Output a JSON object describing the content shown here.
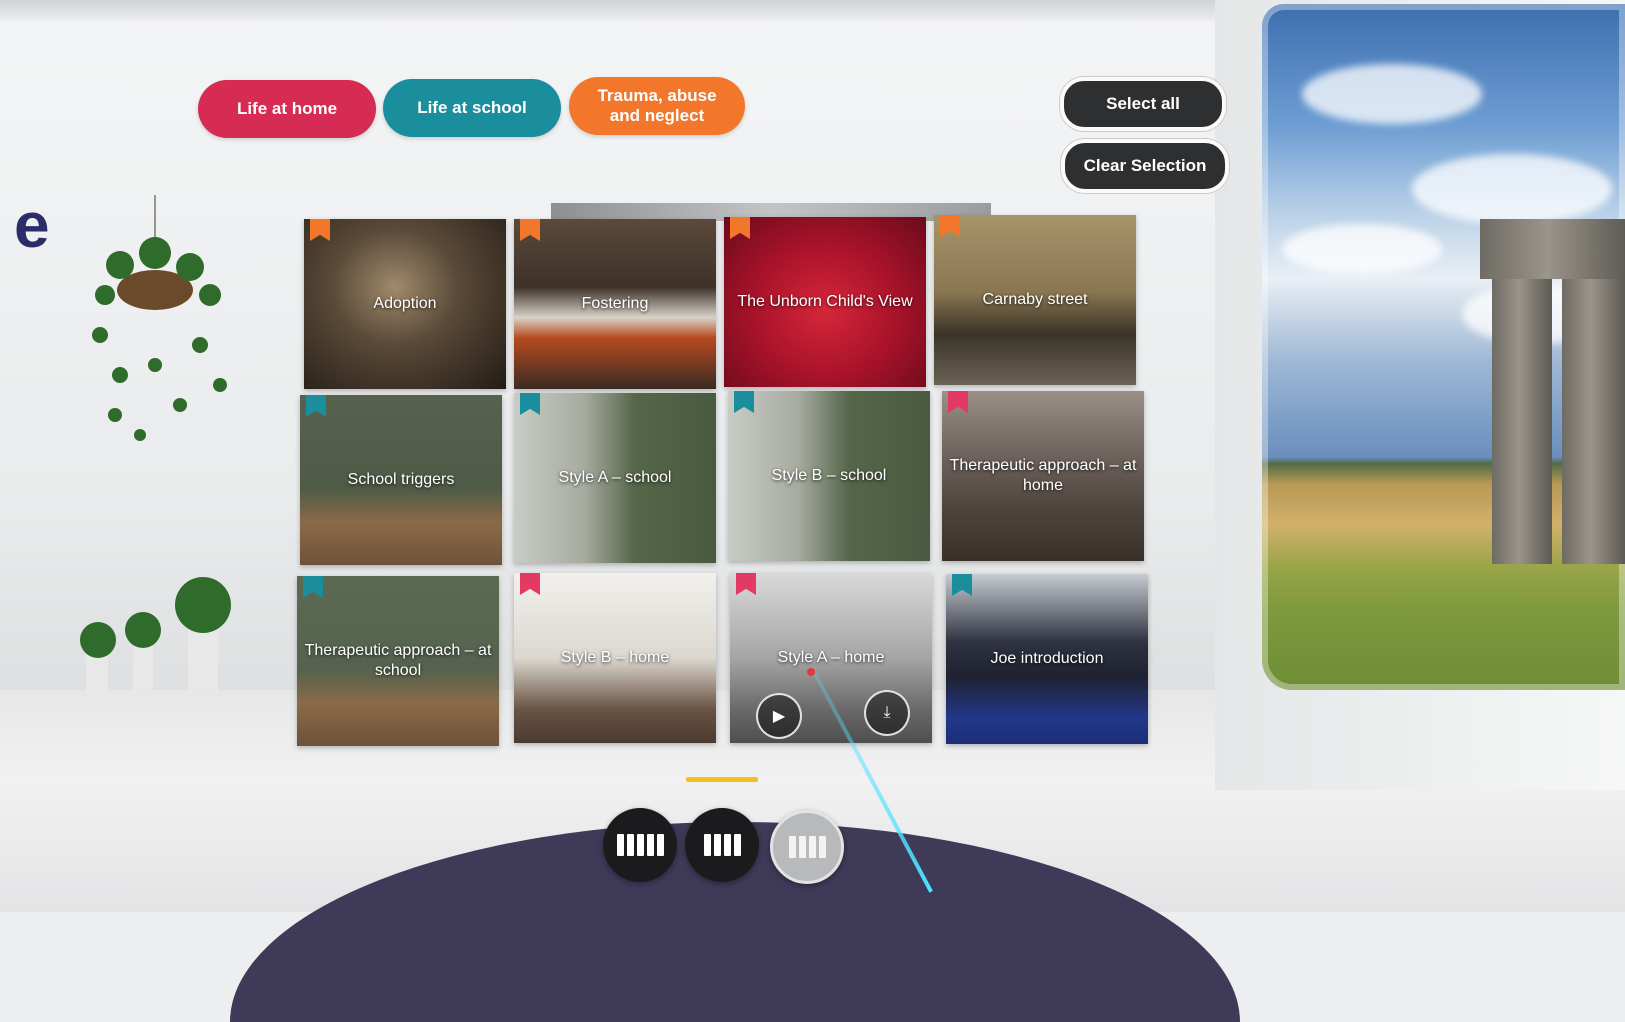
{
  "categories": [
    {
      "label": "Life at home",
      "color": "#d62b52"
    },
    {
      "label": "Life at school",
      "color": "#1a8e9c"
    },
    {
      "label": "Trauma, abuse\nand neglect",
      "color": "#f2772a"
    }
  ],
  "actions": {
    "select_all": "Select all",
    "clear_selection": "Clear Selection"
  },
  "tiles": [
    {
      "title": "Adoption",
      "category": "trauma"
    },
    {
      "title": "Fostering",
      "category": "trauma"
    },
    {
      "title": "The Unborn Child's View",
      "category": "trauma"
    },
    {
      "title": "Carnaby street",
      "category": "trauma"
    },
    {
      "title": "School triggers",
      "category": "school"
    },
    {
      "title": "Style A – school",
      "category": "school"
    },
    {
      "title": "Style B – school",
      "category": "school"
    },
    {
      "title": "Therapeutic approach – at home",
      "category": "home"
    },
    {
      "title": "Therapeutic approach – at school",
      "category": "school"
    },
    {
      "title": "Style B – home",
      "category": "home"
    },
    {
      "title": "Style A – home",
      "category": "home"
    },
    {
      "title": "Joe introduction",
      "category": "school"
    }
  ],
  "tile_controls": {
    "play_icon": "play-icon",
    "download_icon": "download-icon"
  },
  "layout_options": [
    {
      "name": "five-column-layout",
      "active": false
    },
    {
      "name": "four-column-layout",
      "active": false
    },
    {
      "name": "grid-layout",
      "active": true
    }
  ],
  "environment": {
    "wall_letter": "e"
  }
}
